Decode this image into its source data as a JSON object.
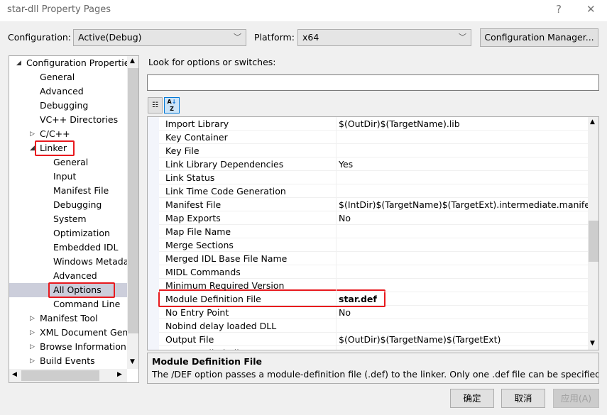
{
  "window": {
    "title": "star-dll Property Pages",
    "help": "?",
    "close": "✕"
  },
  "toolbar": {
    "config_label": "Configuration:",
    "config_value": "Active(Debug)",
    "platform_label": "Platform:",
    "platform_value": "x64",
    "config_manager": "Configuration Manager..."
  },
  "search": {
    "label": "Look for options or switches:",
    "value": ""
  },
  "view_buttons": {
    "categorized_icon": "categorized-icon",
    "alphabetical_icon": "sort-az-icon"
  },
  "tree": [
    {
      "label": "Configuration Properties",
      "level": 0,
      "arrow": "expanded"
    },
    {
      "label": "General",
      "level": 1
    },
    {
      "label": "Advanced",
      "level": 1
    },
    {
      "label": "Debugging",
      "level": 1
    },
    {
      "label": "VC++ Directories",
      "level": 1
    },
    {
      "label": "C/C++",
      "level": 1,
      "arrow": "collapsed"
    },
    {
      "label": "Linker",
      "level": 1,
      "arrow": "expanded",
      "highlight": true
    },
    {
      "label": "General",
      "level": 2
    },
    {
      "label": "Input",
      "level": 2
    },
    {
      "label": "Manifest File",
      "level": 2
    },
    {
      "label": "Debugging",
      "level": 2
    },
    {
      "label": "System",
      "level": 2
    },
    {
      "label": "Optimization",
      "level": 2
    },
    {
      "label": "Embedded IDL",
      "level": 2
    },
    {
      "label": "Windows Metadata",
      "level": 2
    },
    {
      "label": "Advanced",
      "level": 2
    },
    {
      "label": "All Options",
      "level": 2,
      "selected": true,
      "highlight": true
    },
    {
      "label": "Command Line",
      "level": 2
    },
    {
      "label": "Manifest Tool",
      "level": 1,
      "arrow": "collapsed"
    },
    {
      "label": "XML Document Generator",
      "level": 1,
      "arrow": "collapsed"
    },
    {
      "label": "Browse Information",
      "level": 1,
      "arrow": "collapsed"
    },
    {
      "label": "Build Events",
      "level": 1,
      "arrow": "collapsed"
    }
  ],
  "properties": [
    {
      "name": "Import Library",
      "value": "$(OutDir)$(TargetName).lib"
    },
    {
      "name": "Key Container",
      "value": ""
    },
    {
      "name": "Key File",
      "value": ""
    },
    {
      "name": "Link Library Dependencies",
      "value": "Yes"
    },
    {
      "name": "Link Status",
      "value": ""
    },
    {
      "name": "Link Time Code Generation",
      "value": ""
    },
    {
      "name": "Manifest File",
      "value": "$(IntDir)$(TargetName)$(TargetExt).intermediate.manifest"
    },
    {
      "name": "Map Exports",
      "value": "No"
    },
    {
      "name": "Map File Name",
      "value": ""
    },
    {
      "name": "Merge Sections",
      "value": ""
    },
    {
      "name": "Merged IDL Base File Name",
      "value": ""
    },
    {
      "name": "MIDL Commands",
      "value": ""
    },
    {
      "name": "Minimum Required Version",
      "value": ""
    },
    {
      "name": "Module Definition File",
      "value": "star.def",
      "selected": true,
      "bold": true
    },
    {
      "name": "No Entry Point",
      "value": "No"
    },
    {
      "name": "Nobind delay loaded DLL",
      "value": ""
    },
    {
      "name": "Output File",
      "value": "$(OutDir)$(TargetName)$(TargetExt)"
    },
    {
      "name": "Prevent Dll Binding",
      "value": "No"
    }
  ],
  "description": {
    "title": "Module Definition File",
    "text": "The /DEF option passes a module-definition file (.def) to the linker. Only one .def file can be specified to"
  },
  "buttons": {
    "ok": "确定",
    "cancel": "取消",
    "apply": "应用(A)"
  },
  "colors": {
    "highlight": "#e8191e",
    "selection": "#cccedb"
  }
}
